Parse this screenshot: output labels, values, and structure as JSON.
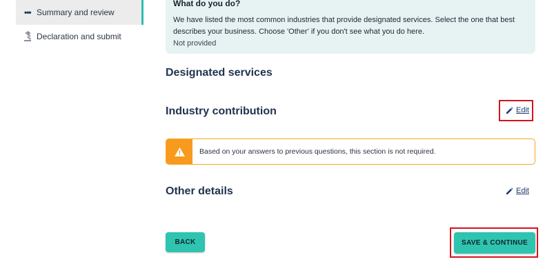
{
  "sidebar": {
    "items": [
      {
        "label": "Summary and review",
        "icon": "ellipsis-icon",
        "active": true
      },
      {
        "label": "Declaration and submit",
        "icon": "gavel-icon",
        "active": false
      }
    ]
  },
  "info": {
    "question": "What do you do?",
    "description": "We have listed the most common industries that provide designated services. Select the one that best describes your business. Choose 'Other' if you don't see what you do here.",
    "value": "Not provided"
  },
  "sections": {
    "designated_services": {
      "title": "Designated services"
    },
    "industry_contribution": {
      "title": "Industry contribution",
      "edit_label": "Edit"
    },
    "alert": {
      "text": "Based on your answers to previous questions, this section is not required."
    },
    "other_details": {
      "title": "Other details",
      "edit_label": "Edit"
    }
  },
  "footer": {
    "back_label": "BACK",
    "save_label": "SAVE & CONTINUE"
  },
  "colors": {
    "accent": "#2ec4b0",
    "warning": "#f79a1e",
    "highlight": "#d4131b",
    "heading": "#20344f"
  }
}
